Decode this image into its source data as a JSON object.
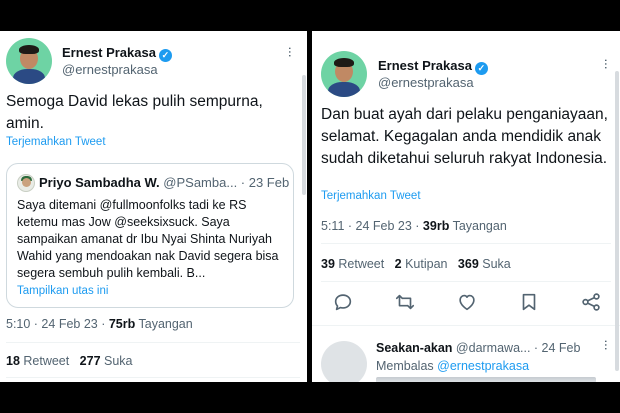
{
  "left": {
    "author_name": "Ernest Prakasa",
    "author_handle": "@ernestprakasa",
    "tweet_text": "Semoga David lekas pulih sempurna, amin.",
    "translate_label": "Terjemahkan Tweet",
    "quote": {
      "name": "Priyo Sambadha W.",
      "handle_date": "@PSamba... · 23 Feb",
      "text": "Saya ditemani @fullmoonfolks tadi ke RS ketemu mas Jow @seeksixsuck. Saya sampaikan amanat dr Ibu Nyai Shinta Nuriyah Wahid yang mendoakan nak David segera bisa segera sembuh pulih kembali. B...",
      "show_thread": "Tampilkan utas ini"
    },
    "time": "5:10 · 24 Feb 23 · ",
    "views_count": "75rb",
    "views_label": " Tayangan",
    "retweets_count": "18",
    "retweets_label": " Retweet",
    "likes_count": "277",
    "likes_label": " Suka"
  },
  "right": {
    "author_name": "Ernest Prakasa",
    "author_handle": "@ernestprakasa",
    "tweet_text": "Dan buat ayah dari pelaku penganiayaan, selamat. Kegagalan anda mendidik anak sudah diketahui seluruh rakyat Indonesia.",
    "translate_label": "Terjemahkan Tweet",
    "time": "5:11 · 24 Feb 23 · ",
    "views_count": "39rb",
    "views_label": " Tayangan",
    "retweets_count": "39",
    "retweets_label": " Retweet",
    "quotes_count": "2",
    "quotes_label": " Kutipan",
    "likes_count": "369",
    "likes_label": " Suka",
    "reply": {
      "name": "Seakan-akan",
      "handle_date": "@darmawa... · 24 Feb",
      "replying_prefix": "Membalas ",
      "replying_handle": "@ernestprakasa"
    }
  },
  "colors": {
    "accent": "#1d9bf0",
    "secondary_text": "#536471",
    "primary_text": "#0f1419",
    "avatar_bg": "#6ed3a4"
  },
  "icons": [
    "verified-icon",
    "more-icon",
    "reply-icon",
    "retweet-icon",
    "like-icon",
    "bookmark-icon",
    "share-icon"
  ]
}
